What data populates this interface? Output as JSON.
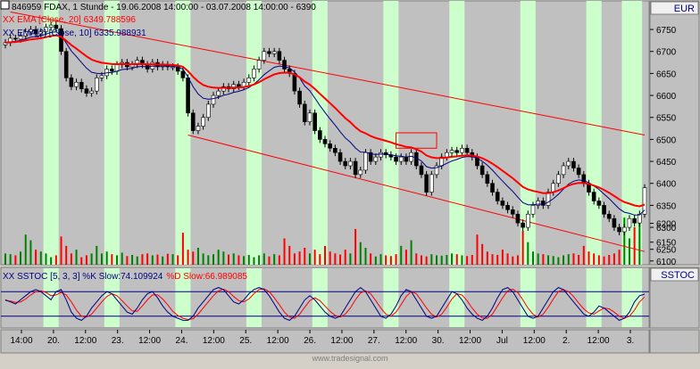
{
  "header": {
    "symbol_line": "846959  FDAX, 1 Stunde - 19.06.2008 14:00:00 - 03.07.2008 14:00:00 - 6390",
    "ema20_legend": "XX EMA [Close, 20] 6349.788596",
    "ema10_legend": "XX EMA[2] [Close, 10] 6335.988931"
  },
  "right_panel": {
    "currency": "EUR",
    "stoch_label": "SSTOC"
  },
  "stoch": {
    "legend_prefix": "XX SSTOC [5, 3, 3] ",
    "k_legend": "%K Slow:74.109924",
    "d_legend": "%D Slow:66.989085"
  },
  "watermark": "www.tradesignal.com",
  "colors": {
    "background": "#c0c0c0",
    "highlight_band": "#ccffcc",
    "ema20": "#ff0000",
    "ema10": "#000080",
    "up_bar": "#008000",
    "down_bar": "#ff0000",
    "channel": "#ff0000",
    "candle": "#000000",
    "stoch_k": "#000080",
    "stoch_d": "#ff0000"
  },
  "chart_data": {
    "type": "candlestick",
    "title": "FDAX, 1 Stunde",
    "timeframe": "1 Stunde",
    "date_range": [
      "19.06.2008 14:00:00",
      "03.07.2008 14:00:00"
    ],
    "last_price": 6390,
    "x_labels": [
      "14:00",
      "20.",
      "12:00",
      "23.",
      "12:00",
      "24.",
      "12:00",
      "25.",
      "12:00",
      "26.",
      "12:00",
      "27.",
      "12:00",
      "30.",
      "12:00",
      "Jul",
      "12:00",
      "2.",
      "12:00",
      "3."
    ],
    "price_axis": {
      "ticks": [
        6750,
        6700,
        6650,
        6600,
        6550,
        6500,
        6450,
        6400,
        6350,
        6300,
        6250
      ],
      "ylim": [
        6215,
        6815
      ]
    },
    "volume_axis": {
      "ticks": [
        6200,
        6150,
        6100
      ],
      "ylim": [
        6090,
        6225
      ]
    },
    "closes": [
      6720,
      6730,
      6728,
      6735,
      6745,
      6750,
      6740,
      6745,
      6755,
      6760,
      6752,
      6700,
      6640,
      6620,
      6630,
      6615,
      6605,
      6610,
      6640,
      6645,
      6660,
      6655,
      6670,
      6675,
      6665,
      6670,
      6680,
      6670,
      6660,
      6675,
      6665,
      6670,
      6665,
      6665,
      6655,
      6640,
      6560,
      6520,
      6530,
      6550,
      6580,
      6600,
      6610,
      6620,
      6615,
      6625,
      6620,
      6630,
      6640,
      6660,
      6680,
      6700,
      6695,
      6700,
      6680,
      6660,
      6650,
      6610,
      6580,
      6540,
      6560,
      6520,
      6500,
      6490,
      6480,
      6470,
      6450,
      6440,
      6450,
      6420,
      6430,
      6470,
      6450,
      6460,
      6470,
      6465,
      6460,
      6450,
      6460,
      6450,
      6470,
      6440,
      6420,
      6380,
      6420,
      6440,
      6460,
      6470,
      6475,
      6470,
      6480,
      6470,
      6460,
      6440,
      6420,
      6400,
      6380,
      6360,
      6350,
      6340,
      6330,
      6310,
      6300,
      6330,
      6350,
      6360,
      6350,
      6380,
      6400,
      6420,
      6440,
      6450,
      6435,
      6420,
      6400,
      6380,
      6360,
      6350,
      6330,
      6320,
      6300,
      6290,
      6300,
      6320,
      6310,
      6330,
      6390
    ],
    "volume": [
      6120,
      6118,
      6115,
      6125,
      6170,
      6155,
      6130,
      6125,
      6120,
      6110,
      6115,
      6165,
      6140,
      6120,
      6130,
      6110,
      6115,
      6120,
      6140,
      6120,
      6125,
      6118,
      6115,
      6122,
      6113,
      6116,
      6112,
      6118,
      6120,
      6115,
      6117,
      6112,
      6119,
      6118,
      6115,
      6175,
      6130,
      6125,
      6135,
      6120,
      6115,
      6118,
      6130,
      6125,
      6117,
      6120,
      6115,
      6113,
      6116,
      6110,
      6115,
      6120,
      6112,
      6118,
      6115,
      6160,
      6140,
      6120,
      6125,
      6135,
      6120,
      6130,
      6118,
      6140,
      6125,
      6120,
      6117,
      6130,
      6120,
      6185,
      6150,
      6135,
      6120,
      6112,
      6118,
      6115,
      6113,
      6118,
      6140,
      6130,
      6155,
      6120,
      6115,
      6112,
      6118,
      6115,
      6114,
      6116,
      6120,
      6118,
      6115,
      6113,
      6116,
      6170,
      6145,
      6125,
      6118,
      6116,
      6130,
      6120,
      6112,
      6115,
      6180,
      6150,
      6125,
      6120,
      6118,
      6115,
      6113,
      6110,
      6115,
      6118,
      6120,
      6116,
      6140,
      6125,
      6120,
      6115,
      6112,
      6116,
      6120,
      6130,
      6215,
      6160,
      6190,
      6210
    ],
    "series": [
      {
        "name": "EMA [Close, 20]",
        "last": 6349.788596
      },
      {
        "name": "EMA[2] [Close, 10]",
        "last": 6335.988931
      }
    ],
    "channel": {
      "upper": {
        "from_bar": 1,
        "from": 6790,
        "to_bar": 126,
        "to": 6510
      },
      "lower": {
        "from_bar": 36,
        "from": 6510,
        "to_bar": 126,
        "to": 6245
      }
    },
    "rectangle": {
      "from_bar": 77,
      "to_bar": 85,
      "top": 6515,
      "bottom": 6480
    },
    "highlight_bands": [
      [
        8,
        11
      ],
      [
        20,
        23
      ],
      [
        34,
        37
      ],
      [
        48,
        51
      ],
      [
        61,
        64
      ],
      [
        75,
        78
      ],
      [
        88,
        91
      ],
      [
        102,
        105
      ],
      [
        115,
        118
      ],
      [
        122,
        126
      ]
    ],
    "stochastic": {
      "params": "[5, 3, 3]",
      "k_last": 74.109924,
      "d_last": 66.989085,
      "levels": [
        80,
        20
      ],
      "k": [
        60,
        55,
        50,
        60,
        70,
        80,
        85,
        80,
        70,
        60,
        80,
        85,
        60,
        30,
        15,
        10,
        20,
        40,
        55,
        70,
        80,
        75,
        60,
        45,
        30,
        25,
        40,
        60,
        75,
        80,
        65,
        45,
        30,
        20,
        15,
        10,
        10,
        20,
        40,
        55,
        70,
        85,
        90,
        85,
        70,
        55,
        50,
        60,
        75,
        85,
        90,
        85,
        70,
        50,
        30,
        15,
        10,
        20,
        40,
        60,
        70,
        60,
        45,
        30,
        20,
        15,
        20,
        40,
        60,
        80,
        90,
        80,
        60,
        40,
        20,
        15,
        25,
        45,
        70,
        85,
        80,
        60,
        40,
        20,
        15,
        20,
        40,
        60,
        80,
        75,
        60,
        40,
        25,
        15,
        10,
        20,
        40,
        65,
        85,
        90,
        80,
        60,
        40,
        20,
        15,
        20,
        40,
        60,
        80,
        90,
        85,
        70,
        55,
        40,
        25,
        20,
        30,
        45,
        40,
        30,
        20,
        10,
        15,
        30,
        55,
        70,
        74
      ],
      "d": [
        58,
        57,
        54,
        55,
        62,
        72,
        80,
        82,
        78,
        70,
        72,
        78,
        72,
        55,
        35,
        20,
        18,
        25,
        40,
        55,
        68,
        75,
        70,
        58,
        45,
        33,
        32,
        45,
        60,
        72,
        72,
        62,
        48,
        32,
        22,
        15,
        12,
        14,
        25,
        40,
        55,
        70,
        82,
        86,
        80,
        68,
        58,
        55,
        62,
        75,
        85,
        87,
        80,
        65,
        48,
        30,
        18,
        15,
        25,
        42,
        58,
        65,
        58,
        45,
        32,
        22,
        18,
        25,
        40,
        60,
        77,
        82,
        75,
        58,
        40,
        25,
        20,
        30,
        48,
        68,
        80,
        75,
        58,
        40,
        25,
        18,
        25,
        42,
        62,
        75,
        72,
        58,
        40,
        25,
        16,
        15,
        25,
        45,
        65,
        82,
        86,
        78,
        60,
        40,
        25,
        18,
        25,
        42,
        62,
        80,
        85,
        80,
        68,
        52,
        38,
        28,
        25,
        33,
        40,
        38,
        30,
        20,
        15,
        20,
        35,
        55,
        67
      ]
    }
  }
}
